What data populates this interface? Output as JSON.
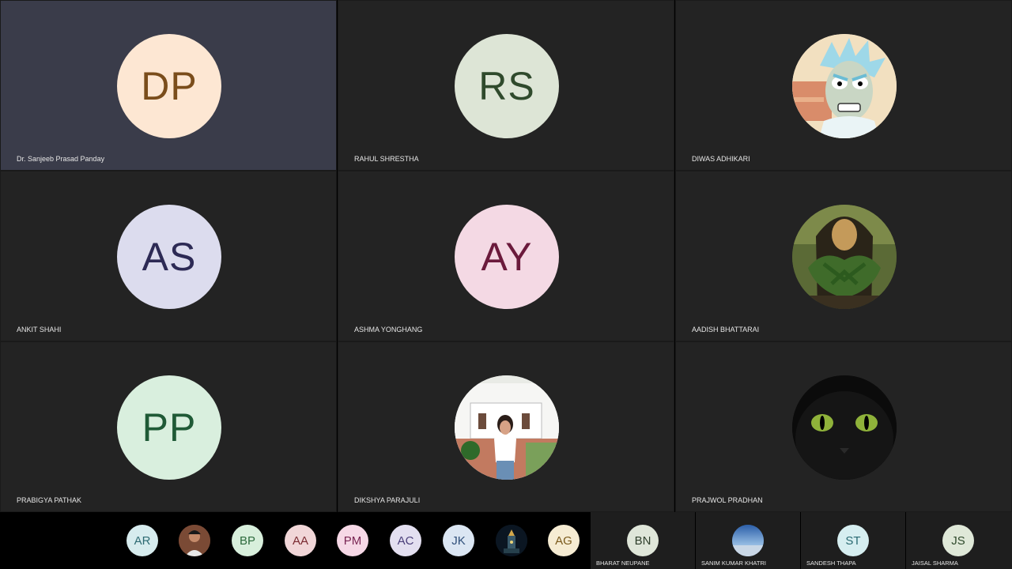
{
  "main_tiles": [
    {
      "initials": "DP",
      "name": "Dr. Sanjeeb Prasad Panday",
      "bg": "#fde7d3",
      "fg": "#7a4d1b"
    },
    {
      "initials": "RS",
      "name": "RAHUL SHRESTHA",
      "bg": "#dde5d6",
      "fg": "#2f4a2c"
    },
    {
      "initials": "",
      "name": "DIWAS ADHIKARI",
      "avatar_icon": "cartoon-scientist-avatar-icon"
    },
    {
      "initials": "AS",
      "name": "ANKIT SHAHI",
      "bg": "#dcdcee",
      "fg": "#2d2a55"
    },
    {
      "initials": "AY",
      "name": "ASHMA YONGHANG",
      "bg": "#f4d9e4",
      "fg": "#6b1a3c"
    },
    {
      "initials": "",
      "name": "AADISH BHATTARAI",
      "avatar_icon": "painting-portrait-avatar-icon"
    },
    {
      "initials": "PP",
      "name": "PRABIGYA PATHAK",
      "bg": "#d9efde",
      "fg": "#1f5a36"
    },
    {
      "initials": "",
      "name": "DIKSHYA PARAJULI",
      "avatar_icon": "person-photo-avatar-icon"
    },
    {
      "initials": "",
      "name": "PRAJWOL PRADHAN",
      "avatar_icon": "black-cat-avatar-icon"
    }
  ],
  "strip_avatars": [
    {
      "initials": "AR",
      "bg": "#d7ecee",
      "fg": "#2e6b73"
    },
    {
      "initials": "",
      "avatar_icon": "person-photo-icon"
    },
    {
      "initials": "BP",
      "bg": "#d8efdc",
      "fg": "#2d6b3d"
    },
    {
      "initials": "AA",
      "bg": "#f1d6d8",
      "fg": "#7a2a31"
    },
    {
      "initials": "PM",
      "bg": "#f6d8e6",
      "fg": "#7a2654"
    },
    {
      "initials": "AC",
      "bg": "#e3dff0",
      "fg": "#4b3f7a"
    },
    {
      "initials": "JK",
      "bg": "#dbe6f3",
      "fg": "#2f4f7a"
    },
    {
      "initials": "",
      "avatar_icon": "night-temple-icon"
    },
    {
      "initials": "AG",
      "bg": "#f6ecd3",
      "fg": "#7a5a1c"
    }
  ],
  "small_tiles": [
    {
      "initials": "BN",
      "name": "BHARAT NEUPANE",
      "bg": "#dfe6d9",
      "fg": "#2f3f2c"
    },
    {
      "initials": "",
      "name": "SANIM KUMAR KHATRI",
      "avatar_icon": "sky-horizon-avatar-icon"
    },
    {
      "initials": "ST",
      "name": "SANDESH THAPA",
      "bg": "#d6eef0",
      "fg": "#2a6a72"
    },
    {
      "initials": "JS",
      "name": "JAISAL SHARMA",
      "bg": "#dfe8d8",
      "fg": "#2f4a2c"
    }
  ]
}
